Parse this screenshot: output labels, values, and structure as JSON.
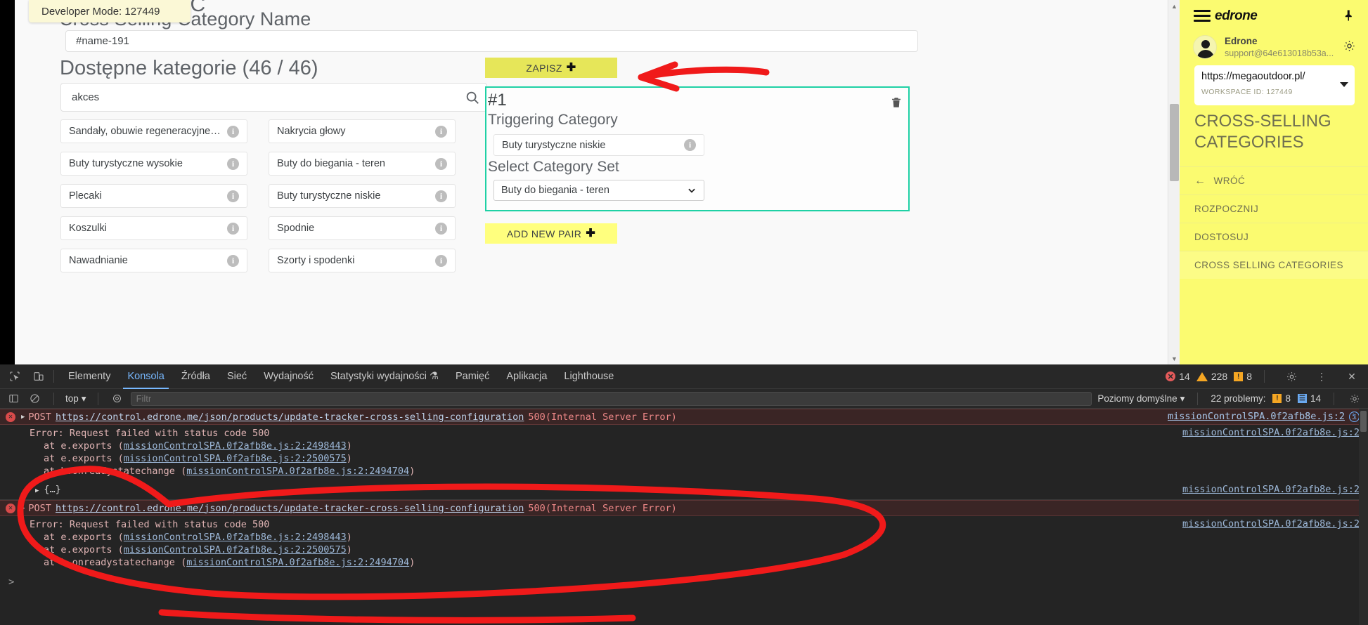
{
  "tooltip": {
    "text": "Developer Mode: 127449"
  },
  "page": {
    "heading_clipped": "Cross Selling C",
    "heading_name": "Cross Selling Category Name",
    "name_value": "#name-191",
    "available_heading": "Dostępne kategorie (46 / 46)",
    "search_value": "akces",
    "search_placeholder": "",
    "categories_left": [
      "Sandały, obuwie regeneracyjne i miejskie",
      "Buty turystyczne wysokie",
      "Plecaki",
      "Koszulki",
      "Nawadnianie"
    ],
    "categories_right": [
      "Nakrycia głowy",
      "Buty do biegania - teren",
      "Buty turystyczne niskie",
      "Spodnie",
      "Szorty i spodenki"
    ]
  },
  "form": {
    "save_label": "ZAPISZ",
    "add_pair_label": "ADD NEW PAIR",
    "pair_number": "#1",
    "triggering_label": "Triggering Category",
    "triggering_value": "Buty turystyczne niskie",
    "select_set_label": "Select Category Set",
    "select_set_value": "Buty do biegania - teren",
    "accent_border": "#1fd1a5",
    "save_bg": "#e6e659",
    "add_bg": "#ffff7e"
  },
  "edrone": {
    "brand": "edrone",
    "user_name": "Edrone",
    "user_email": "support@64e613018b53a...",
    "workspace_url": "https://megaoutdoor.pl/",
    "workspace_id": "WORKSPACE ID: 127449",
    "section_title": "CROSS-SELLING CATEGORIES",
    "nav": [
      {
        "label": "WRÓĆ",
        "arrow": "←"
      },
      {
        "label": "ROZPOCZNIJ",
        "arrow": ""
      },
      {
        "label": "DOSTOSUJ",
        "arrow": ""
      },
      {
        "label": "CROSS SELLING CATEGORIES",
        "arrow": ""
      }
    ],
    "bg": "#fbfb70"
  },
  "devtools": {
    "tabs": [
      "Elementy",
      "Konsola",
      "Źródła",
      "Sieć",
      "Wydajność",
      "Statystyki wydajności",
      "Pamięć",
      "Aplikacja",
      "Lighthouse"
    ],
    "active_tab": "Konsola",
    "errors_count": "14",
    "warnings_count": "228",
    "info_count": "8",
    "context": "top",
    "filter_placeholder": "Filtr",
    "filter_value": "",
    "levels_label": "Poziomy domyślne",
    "problems_label": "22 problemy:",
    "problems_warn": "8",
    "problems_info": "14"
  },
  "console": {
    "entries": [
      {
        "method": "POST",
        "url": "https://control.edrone.me/json/products/update-tracker-cross-selling-configuration",
        "status": "500",
        "status_text": "(Internal Server Error)",
        "source": "missionControlSPA.0f2afb8e.js:2",
        "stack_header": "Error: Request failed with status code 500",
        "stack": [
          {
            "at": "at e.exports (",
            "link": "missionControlSPA.0f2afb8e.js:2:2498443",
            "close": ")"
          },
          {
            "at": "at e.exports (",
            "link": "missionControlSPA.0f2afb8e.js:2:2500575",
            "close": ")"
          },
          {
            "at": "at b.onreadystatechange (",
            "link": "missionControlSPA.0f2afb8e.js:2:2494704",
            "close": ")"
          }
        ],
        "stack_source": "missionControlSPA.0f2afb8e.js:2"
      },
      {
        "method": "POST",
        "url": "https://control.edrone.me/json/products/update-tracker-cross-selling-configuration",
        "status": "500",
        "status_text": "(Internal Server Error)",
        "source": "missionControlSPA.0f2afb8e.js:2",
        "stack_header": "Error: Request failed with status code 500",
        "stack": [
          {
            "at": "at e.exports (",
            "link": "missionControlSPA.0f2afb8e.js:2:2498443",
            "close": ")"
          },
          {
            "at": "at e.exports (",
            "link": "missionControlSPA.0f2afb8e.js:2:2500575",
            "close": ")"
          },
          {
            "at": "at b.onreadystatechange (",
            "link": "missionControlSPA.0f2afb8e.js:2:2494704",
            "close": ")"
          }
        ],
        "stack_source": "missionControlSPA.0f2afb8e.js:2"
      }
    ],
    "object_row": "{…}",
    "object_row_source": "missionControlSPA.0f2afb8e.js:2",
    "prompt": ">"
  },
  "annotations": {
    "color": "#f01a1a"
  }
}
